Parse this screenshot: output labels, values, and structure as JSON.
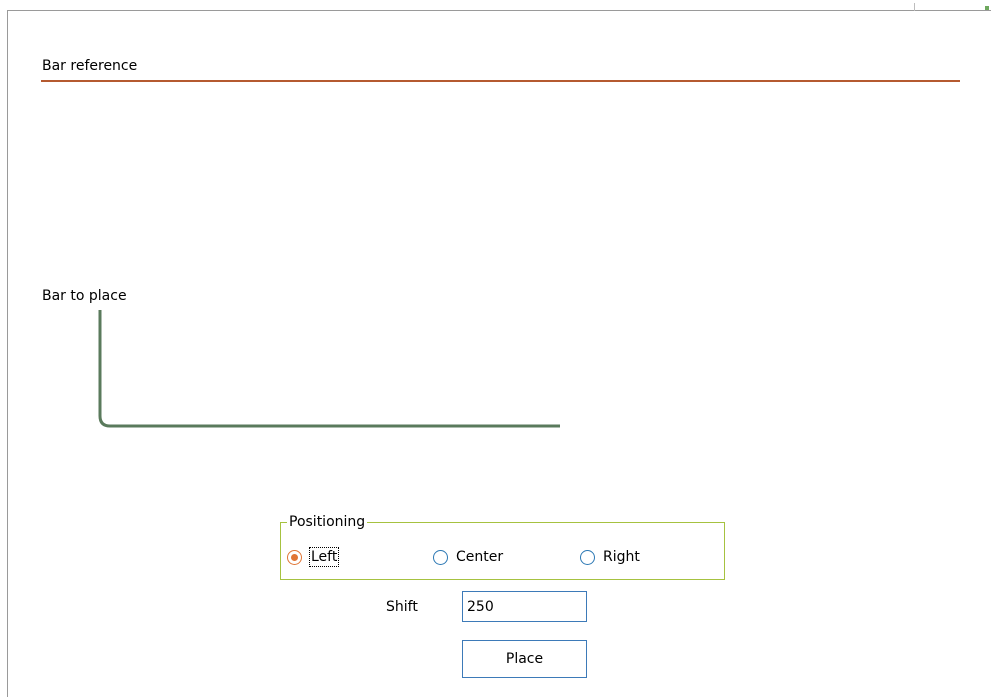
{
  "bar_reference": {
    "label": "Bar reference",
    "line_color": "#b55a30"
  },
  "bar_to_place": {
    "label": "Bar to place",
    "shape_color": "#5a7a5c"
  },
  "positioning": {
    "title": "Positioning",
    "border_color": "#a6c240",
    "options": [
      {
        "label": "Left",
        "checked": true,
        "focused": true
      },
      {
        "label": "Center",
        "checked": false
      },
      {
        "label": "Right",
        "checked": false
      }
    ],
    "selected": "Left"
  },
  "shift": {
    "label": "Shift",
    "value": "250"
  },
  "place_button": {
    "label": "Place"
  },
  "colors": {
    "accent": "#e07535",
    "control_border": "#3d7ab8"
  }
}
